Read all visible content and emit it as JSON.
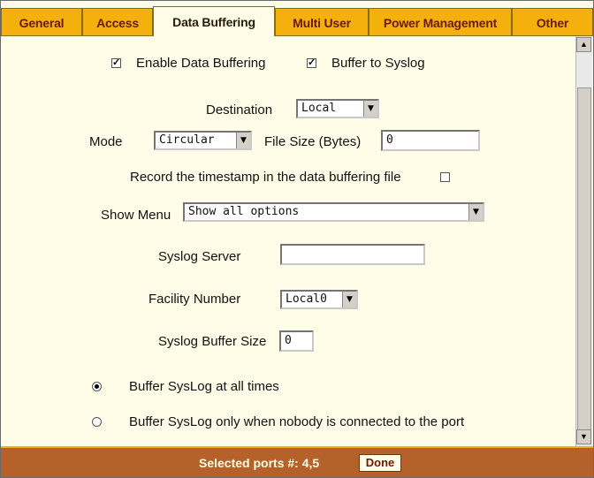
{
  "tabs": [
    {
      "label": "General"
    },
    {
      "label": "Access"
    },
    {
      "label": "Data Buffering"
    },
    {
      "label": "Multi User"
    },
    {
      "label": "Power Management"
    },
    {
      "label": "Other"
    }
  ],
  "active_tab": "Data Buffering",
  "form": {
    "enable_buffering_label": "Enable Data Buffering",
    "enable_buffering_checked": true,
    "buffer_syslog_label": "Buffer to Syslog",
    "buffer_syslog_checked": true,
    "destination_label": "Destination",
    "destination_value": "Local",
    "mode_label": "Mode",
    "mode_value": "Circular",
    "file_size_label": "File Size (Bytes)",
    "file_size_value": "0",
    "timestamp_label": "Record the timestamp in the data buffering file",
    "timestamp_checked": false,
    "show_menu_label": "Show Menu",
    "show_menu_value": "Show all options",
    "syslog_server_label": "Syslog Server",
    "syslog_server_value": "",
    "facility_label": "Facility Number",
    "facility_value": "Local0",
    "syslog_buffer_label": "Syslog Buffer Size",
    "syslog_buffer_value": "0",
    "radio_always_label": "Buffer SysLog at all times",
    "radio_always_selected": true,
    "radio_nobody_label": "Buffer SysLog only when nobody is connected to the port",
    "radio_nobody_selected": false
  },
  "footer": {
    "selected_ports_label": "Selected ports #: 4,5",
    "done_label": "Done"
  },
  "icons": {
    "checkbox_mark": "☑",
    "select_arrow": "▼",
    "scroll_up": "▲",
    "scroll_down": "▼"
  },
  "colors": {
    "tab_bg": "#f4b10e",
    "tab_text": "#6b1a00",
    "content_bg": "#fffde7",
    "footer_bg": "#b5612a"
  }
}
